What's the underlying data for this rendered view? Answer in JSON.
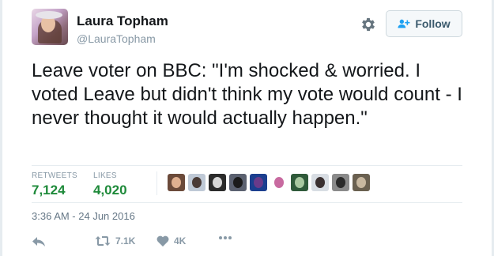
{
  "user": {
    "name": "Laura Topham",
    "handle": "@LauraTopham",
    "avatar_icon": "profile-photo"
  },
  "header": {
    "settings_icon": "gear-icon",
    "follow_label": "Follow",
    "follow_icon": "add-user-icon"
  },
  "tweet": {
    "text": "Leave voter on BBC: \"I'm shocked & worried. I voted Leave but didn't think my vote would count - I never thought it would actually happen.\"",
    "timestamp": "3:36 AM - 24 Jun 2016"
  },
  "stats": {
    "retweets_label": "RETWEETS",
    "retweets_value": "7,124",
    "likes_label": "LIKES",
    "likes_value": "4,020"
  },
  "likers": [
    {
      "bg": "#6b4a3a",
      "face": "#e0b090"
    },
    {
      "bg": "#bfc9d6",
      "face": "#4a3b36"
    },
    {
      "bg": "#2b2b2b",
      "face": "#d8d8d8"
    },
    {
      "bg": "#5b6170",
      "face": "#1b1b1b"
    },
    {
      "bg": "#1c3f8f",
      "face": "#6a3a8a"
    },
    {
      "bg": "#ffffff",
      "face": "#c86aa0"
    },
    {
      "bg": "#2f5a3a",
      "face": "#a8c8a0"
    },
    {
      "bg": "#d8dde3",
      "face": "#3a3030"
    },
    {
      "bg": "#8a8a8a",
      "face": "#2a2a2a"
    },
    {
      "bg": "#6a6050",
      "face": "#c8b8a0"
    }
  ],
  "actions": {
    "reply_icon": "reply-icon",
    "retweet_icon": "retweet-icon",
    "retweet_count": "7.1K",
    "like_icon": "heart-icon",
    "like_count": "4K",
    "more_icon": "more-icon"
  },
  "colors": {
    "stat_green": "#1e8a3a",
    "muted": "#8899a6",
    "text": "#14171a"
  }
}
